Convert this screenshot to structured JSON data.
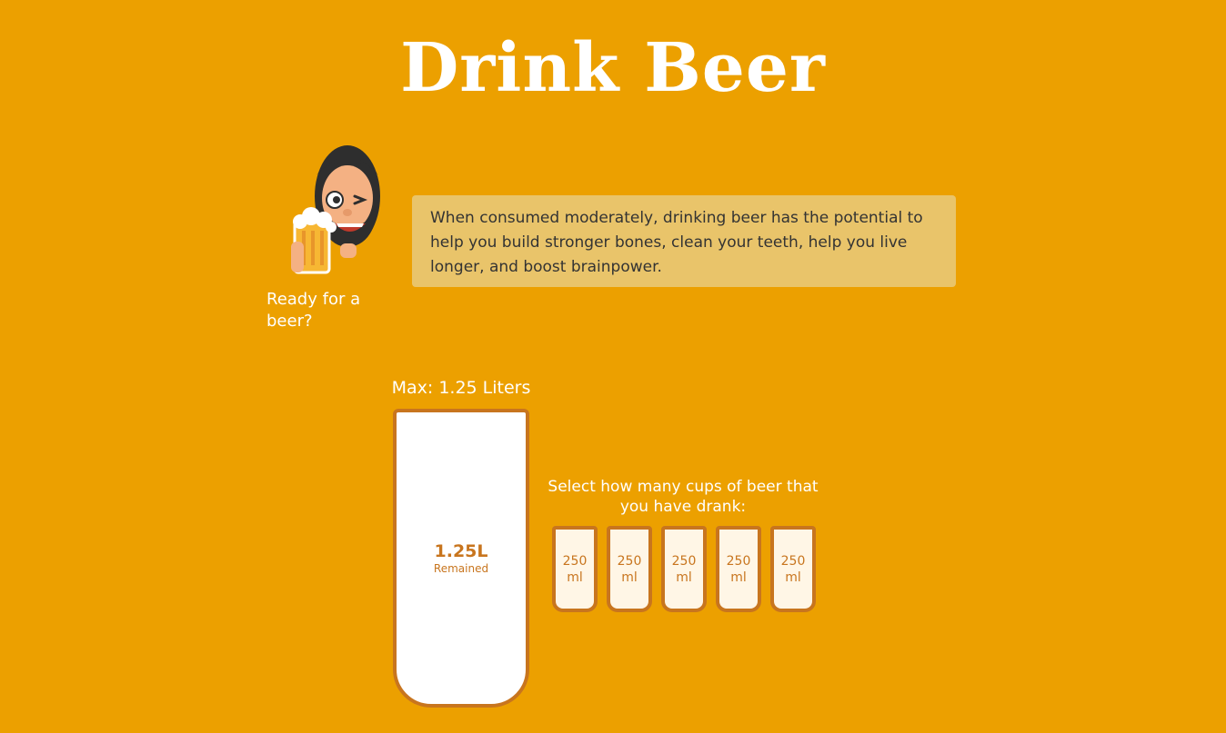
{
  "header": {
    "title": "Drink Beer"
  },
  "intro": {
    "ready_text": "Ready for a beer?",
    "info_text": "When consumed moderately, drinking beer has the potential to help you build stronger bones, clean your teeth, help you live longer, and boost brainpower."
  },
  "tracker": {
    "max_label": "Max: 1.25 Liters",
    "remained_value": "1.25L",
    "remained_label": "Remained",
    "filled_fraction": 0,
    "select_text": "Select how many cups of beer that you have drank:",
    "cups": [
      {
        "label": "250 ml"
      },
      {
        "label": "250 ml"
      },
      {
        "label": "250 ml"
      },
      {
        "label": "250 ml"
      },
      {
        "label": "250 ml"
      }
    ]
  },
  "colors": {
    "background": "#ECA000",
    "accent": "#C8751E",
    "info_box": "#E9C46A",
    "cup_fill": "#FFF6E6"
  },
  "icons": {
    "mascot": "bearded-man-with-beer-mug-icon"
  }
}
